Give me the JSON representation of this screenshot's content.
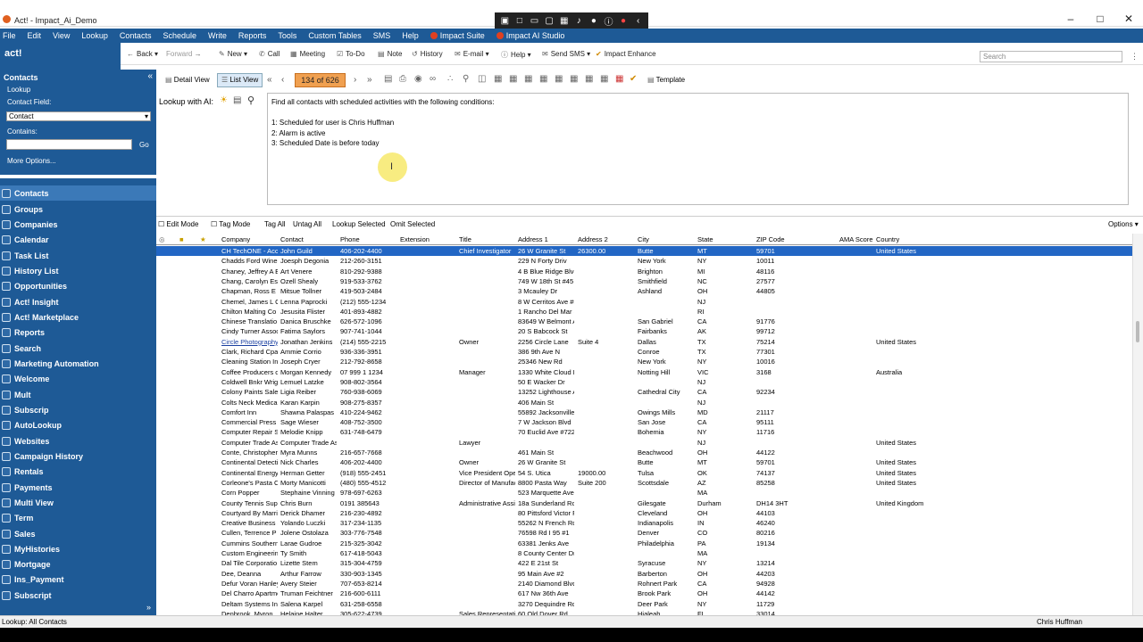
{
  "window": {
    "title": "Act! - Impact_Ai_Demo"
  },
  "menu": [
    "File",
    "Edit",
    "View",
    "Lookup",
    "Contacts",
    "Schedule",
    "Write",
    "Reports",
    "Tools",
    "Custom Tables",
    "SMS",
    "Help",
    "Impact Suite",
    "Impact AI Studio"
  ],
  "logo": "act!",
  "toolbar": {
    "back": "Back",
    "forward": "Forward",
    "new": "New",
    "call": "Call",
    "meeting": "Meeting",
    "todo": "To-Do",
    "note": "Note",
    "history": "History",
    "email": "E-mail",
    "help": "Help",
    "send_sms": "Send SMS",
    "impact_enhance": "Impact Enhance",
    "search_placeholder": "Search"
  },
  "lookup": {
    "header": "Contacts",
    "lookup": "Lookup",
    "field_label": "Contact Field:",
    "field_value": "Contact",
    "contains_label": "Contains:",
    "go": "Go",
    "more": "More Options..."
  },
  "nav": [
    "Contacts",
    "Groups",
    "Companies",
    "Calendar",
    "Task List",
    "History List",
    "Opportunities",
    "Act! Insight",
    "Act! Marketplace",
    "Reports",
    "Search",
    "Marketing Automation",
    "Welcome",
    "Mult",
    "Subscrip",
    "AutoLookup",
    "Websites",
    "Campaign History",
    "Rentals",
    "Payments",
    "Multi View",
    "Term",
    "Sales",
    "MyHistories",
    "Mortgage",
    "Ins_Payment",
    "Subscript"
  ],
  "viewbar": {
    "detail": "Detail View",
    "list": "List View",
    "counter": "134 of 626",
    "template": "Template"
  },
  "ai": {
    "label": "Lookup with AI:",
    "query": "Find all contacts with scheduled activities with the following conditions:\n\n1: Scheduled for user is Chris Huffman\n2: Alarm is active\n3: Scheduled Date is before today"
  },
  "gridbar": {
    "edit_mode": "Edit Mode",
    "tag_mode": "Tag Mode",
    "tag_all": "Tag All",
    "untag_all": "Untag All",
    "lookup_selected": "Lookup Selected",
    "omit_selected": "Omit Selected",
    "options": "Options"
  },
  "columns": [
    "Company",
    "Contact",
    "Phone",
    "Extension",
    "Title",
    "Address 1",
    "Address 2",
    "City",
    "State",
    "ZIP Code",
    "AMA Score",
    "Country"
  ],
  "rows": [
    [
      "CH TechONE - Acc",
      "John Guild",
      "406-202-4400",
      "",
      "Chief Investigator",
      "26 W Granite St",
      "26300.00",
      "Butte",
      "MT",
      "59701",
      "",
      "United States"
    ],
    [
      "Chadds Ford Winer",
      "Joesph Degonia",
      "212-260-3151",
      "",
      "",
      "229 N Forty Driv",
      "",
      "New York",
      "NY",
      "10011",
      "",
      ""
    ],
    [
      "Chaney, Jeffrey A E",
      "Art Venere",
      "810-292-9388",
      "",
      "",
      "4 B Blue Ridge Blvc",
      "",
      "Brighton",
      "MI",
      "48116",
      "",
      ""
    ],
    [
      "Chang, Carolyn Es",
      "Ozell Shealy",
      "919-533-3762",
      "",
      "",
      "749 W 18th St #45",
      "",
      "Smithfield",
      "NC",
      "27577",
      "",
      ""
    ],
    [
      "Chapman, Ross E E",
      "Mitsue Tollner",
      "419-503-2484",
      "",
      "",
      "3 Mcauley Dr",
      "",
      "Ashland",
      "OH",
      "44805",
      "",
      ""
    ],
    [
      "Chemel, James L C",
      "Lenna Paprocki",
      "(212) 555-1234",
      "",
      "",
      "8 W Cerritos Ave #5",
      "",
      "",
      "NJ",
      "",
      "",
      ""
    ],
    [
      "Chilton Malting Co",
      "Jesusita Flister",
      "401-893-4882",
      "",
      "",
      "1 Rancho Del Mar S",
      "",
      "",
      "RI",
      "",
      "",
      ""
    ],
    [
      "Chinese Translatio",
      "Danica Bruschke",
      "626-572-1096",
      "",
      "",
      "83649 W Belmont A",
      "",
      "San Gabriel",
      "CA",
      "91776",
      "",
      ""
    ],
    [
      "Cindy Turner Assoc",
      "Fatima Saylors",
      "907-741-1044",
      "",
      "",
      "20 S Babcock St",
      "",
      "Fairbanks",
      "AK",
      "99712",
      "",
      ""
    ],
    [
      "Circle Photography",
      "Jonathan Jenkins",
      "(214) 555-2215",
      "",
      "Owner",
      "2256 Circle Lane",
      "Suite 4",
      "Dallas",
      "TX",
      "75214",
      "",
      "United States"
    ],
    [
      "Clark, Richard Cpa",
      "Ammie Corrio",
      "936-336-3951",
      "",
      "",
      "386 9th Ave N",
      "",
      "Conroe",
      "TX",
      "77301",
      "",
      ""
    ],
    [
      "Cleaning Station Inc",
      "Joseph Cryer",
      "212-792-8658",
      "",
      "",
      "25346 New Rd",
      "",
      "New York",
      "NY",
      "10016",
      "",
      ""
    ],
    [
      "Coffee Producers o",
      "Morgan Kennedy",
      "07 999 1 1234",
      "",
      "Manager",
      "1330 White Cloud F",
      "",
      "Notting Hill",
      "VIC",
      "3168",
      "",
      "Australia"
    ],
    [
      "Coldwell Bnkr Wrig",
      "Lemuel Latzke",
      "908-802-3564",
      "",
      "",
      "50 E Wacker Dr",
      "",
      "",
      "NJ",
      "",
      "",
      ""
    ],
    [
      "Colony Paints Sale",
      "Ligia Reiber",
      "760-938-6069",
      "",
      "",
      "13252 Lighthouse A",
      "",
      "Cathedral City",
      "CA",
      "92234",
      "",
      ""
    ],
    [
      "Colts Neck Medical",
      "Karan Karpin",
      "908-275-8357",
      "",
      "",
      "406 Main St",
      "",
      "",
      "NJ",
      "",
      "",
      ""
    ],
    [
      "Comfort Inn",
      "Shawna Palaspas",
      "410-224-9462",
      "",
      "",
      "55892 Jacksonville",
      "",
      "Owings Mills",
      "MD",
      "21117",
      "",
      ""
    ],
    [
      "Commercial Press",
      "Sage Wieser",
      "408-752-3500",
      "",
      "",
      "7 W Jackson Blvd",
      "",
      "San Jose",
      "CA",
      "95111",
      "",
      ""
    ],
    [
      "Computer Repair S",
      "Melodie Knipp",
      "631-748-6479",
      "",
      "",
      "70 Euclid Ave #722",
      "",
      "Bohemia",
      "NY",
      "11716",
      "",
      ""
    ],
    [
      "Computer Trade As",
      "Computer Trade As",
      "",
      "",
      "Lawyer",
      "",
      "",
      "",
      "NJ",
      "",
      "",
      "United States"
    ],
    [
      "Conte, Christopher",
      "Myra Munns",
      "216-657-7668",
      "",
      "",
      "461 Main St",
      "",
      "Beachwood",
      "OH",
      "44122",
      "",
      ""
    ],
    [
      "Continental Detecti",
      "Nick Charles",
      "406-202-4400",
      "",
      "Owner",
      "26 W Granite St",
      "",
      "Butte",
      "MT",
      "59701",
      "",
      "United States"
    ],
    [
      "Continental Energy",
      "Herman Getter",
      "(918) 555-2451",
      "",
      "Vice President Ope",
      "54 S. Utica",
      "19000.00",
      "Tulsa",
      "OK",
      "74137",
      "",
      "United States"
    ],
    [
      "Corleone's Pasta C",
      "Morty Manicotti",
      "(480) 555-4512",
      "",
      "Director of Manufac",
      "8800 Pasta Way",
      "Suite 200",
      "Scottsdale",
      "AZ",
      "85258",
      "",
      "United States"
    ],
    [
      "Corn Popper",
      "Stephaine Vinning",
      "978-697-6263",
      "",
      "",
      "523 Marquette Ave",
      "",
      "",
      "MA",
      "",
      "",
      ""
    ],
    [
      "County Tennis Supp",
      "Chris Burn",
      "0191 385643",
      "",
      "Administrative Assi",
      "18a Sunderland Ro",
      "",
      "Gilesgate",
      "Durham",
      "DH14 3HT",
      "",
      "United Kingdom"
    ],
    [
      "Courtyard By Marri",
      "Derick Dhamer",
      "216-230-4892",
      "",
      "",
      "80 Pittsford Victor F",
      "",
      "Cleveland",
      "OH",
      "44103",
      "",
      ""
    ],
    [
      "Creative Business S",
      "Yolando Luczki",
      "317-234-1135",
      "",
      "",
      "55262 N French Rd",
      "",
      "Indianapolis",
      "IN",
      "46240",
      "",
      ""
    ],
    [
      "Cullen, Terrence P",
      "Jolene Ostolaza",
      "303-776-7548",
      "",
      "",
      "76598 Rd  I 95 #1",
      "",
      "Denver",
      "CO",
      "80216",
      "",
      ""
    ],
    [
      "Cummins Southern",
      "Larae Gudroe",
      "215-325-3042",
      "",
      "",
      "63381 Jenks Ave",
      "",
      "Philadelphia",
      "PA",
      "19134",
      "",
      ""
    ],
    [
      "Custom Engineering",
      "Ty Smith",
      "617-418-5043",
      "",
      "",
      "8 County Center Dr",
      "",
      "",
      "MA",
      "",
      "",
      ""
    ],
    [
      "Dal Tile Corporatio",
      "Lizette Stem",
      "315-304-4759",
      "",
      "",
      "422 E 21st St",
      "",
      "Syracuse",
      "NY",
      "13214",
      "",
      ""
    ],
    [
      "Dee, Deanna",
      "Arthur Farrow",
      "330-903-1345",
      "",
      "",
      "95 Main Ave #2",
      "",
      "Barberton",
      "OH",
      "44203",
      "",
      ""
    ],
    [
      "Defur Voran Hanley",
      "Avery Steier",
      "707-653-8214",
      "",
      "",
      "2140 Diamond Blvd",
      "",
      "Rohnert Park",
      "CA",
      "94928",
      "",
      ""
    ],
    [
      "Del Charro Apartme",
      "Truman Feichtner",
      "216-600-6111",
      "",
      "",
      "617 Nw 36th Ave",
      "",
      "Brook Park",
      "OH",
      "44142",
      "",
      ""
    ],
    [
      "Deltam Systems Inc",
      "Salena Karpel",
      "631-258-6558",
      "",
      "",
      "3270 Dequindre Rd",
      "",
      "Deer Park",
      "NY",
      "11729",
      "",
      ""
    ],
    [
      "Denbrook, Myron",
      "Helaine Halter",
      "305-622-4739",
      "",
      "Sales Representati",
      "60 Old Dover Rd",
      "",
      "Hialeah",
      "FL",
      "33014",
      "",
      ""
    ]
  ],
  "status": {
    "left": "Lookup: All Contacts",
    "user": "Chris Huffman"
  }
}
